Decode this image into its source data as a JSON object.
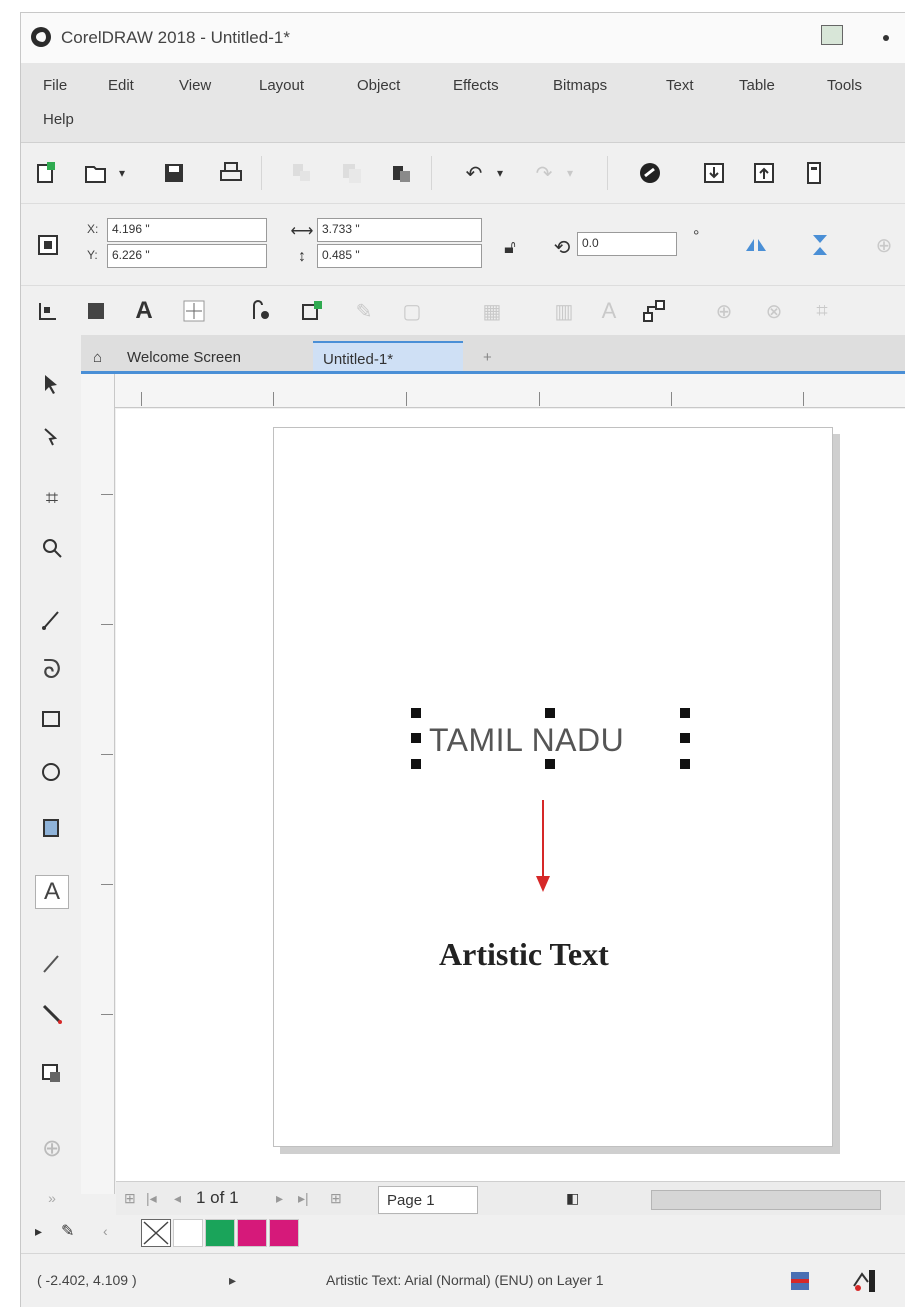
{
  "window": {
    "title": "CorelDRAW 2018 - Untitled-1*"
  },
  "menu": {
    "items": [
      "File",
      "Edit",
      "View",
      "Layout",
      "Object",
      "Effects",
      "Bitmaps",
      "Text",
      "Table",
      "Tools",
      "Help"
    ]
  },
  "toolbar": {
    "icons": [
      "new-document",
      "open",
      "save",
      "print",
      "cut",
      "copy",
      "paste",
      "undo",
      "redo",
      "corel-connect",
      "import",
      "export",
      "publish-pdf"
    ]
  },
  "property_bar": {
    "x_label": "X:",
    "x_value": "4.196 \"",
    "y_label": "Y:",
    "y_value": "6.226 \"",
    "width_value": "3.733 \"",
    "height_value": "0.485 \"",
    "rotation_value": "0.0",
    "degree_symbol": "°"
  },
  "tabs": {
    "welcome": "Welcome Screen",
    "document": "Untitled-1*",
    "add": "+"
  },
  "canvas": {
    "artistic_text": "TAMIL NADU",
    "annotation": "Artistic Text"
  },
  "pagebar": {
    "page_count": "1 of 1",
    "page_tab": "Page 1"
  },
  "palette": {
    "colors": [
      "#ffffff",
      "#1aa45a",
      "#d6197a"
    ]
  },
  "status": {
    "coordinates": "( -2.402, 4.109 )",
    "arrow": "▸",
    "object_info": "Artistic Text: Arial (Normal) (ENU) on Layer 1"
  }
}
